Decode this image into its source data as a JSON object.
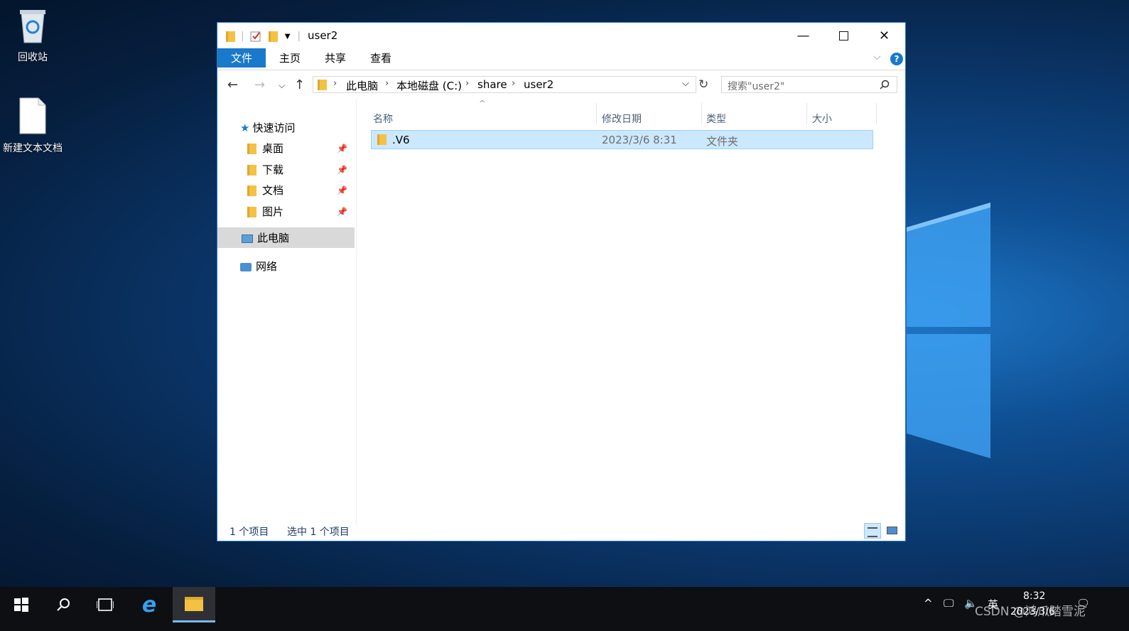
{
  "desktop": {
    "icons": [
      {
        "label": "回收站",
        "icon": "recycle-bin-icon"
      },
      {
        "label": "新建文本文档",
        "icon": "text-document-icon"
      }
    ]
  },
  "window": {
    "title": "user2",
    "ribbon_tabs": [
      "文件",
      "主页",
      "共享",
      "查看"
    ],
    "address": {
      "crumbs": [
        "此电脑",
        "本地磁盘 (C:)",
        "share",
        "user2"
      ]
    },
    "search": {
      "placeholder": "搜索\"user2\""
    },
    "nav": {
      "quick_access": "快速访问",
      "pinned": [
        "桌面",
        "下载",
        "文档",
        "图片"
      ],
      "this_pc": "此电脑",
      "network": "网络"
    },
    "columns": [
      "名称",
      "修改日期",
      "类型",
      "大小"
    ],
    "files": [
      {
        "name": ".V6",
        "modified": "2023/3/6 8:31",
        "type": "文件夹",
        "size": ""
      }
    ],
    "status": {
      "count": "1 个项目",
      "selected": "选中 1 个项目"
    }
  },
  "taskbar": {
    "ime": "英",
    "time": "8:32",
    "date": "2023/3/6",
    "watermark": "CSDN @鸿爪踏雪泥"
  },
  "colors": {
    "accent": "#1979ca",
    "selection": "#cce8ff"
  }
}
